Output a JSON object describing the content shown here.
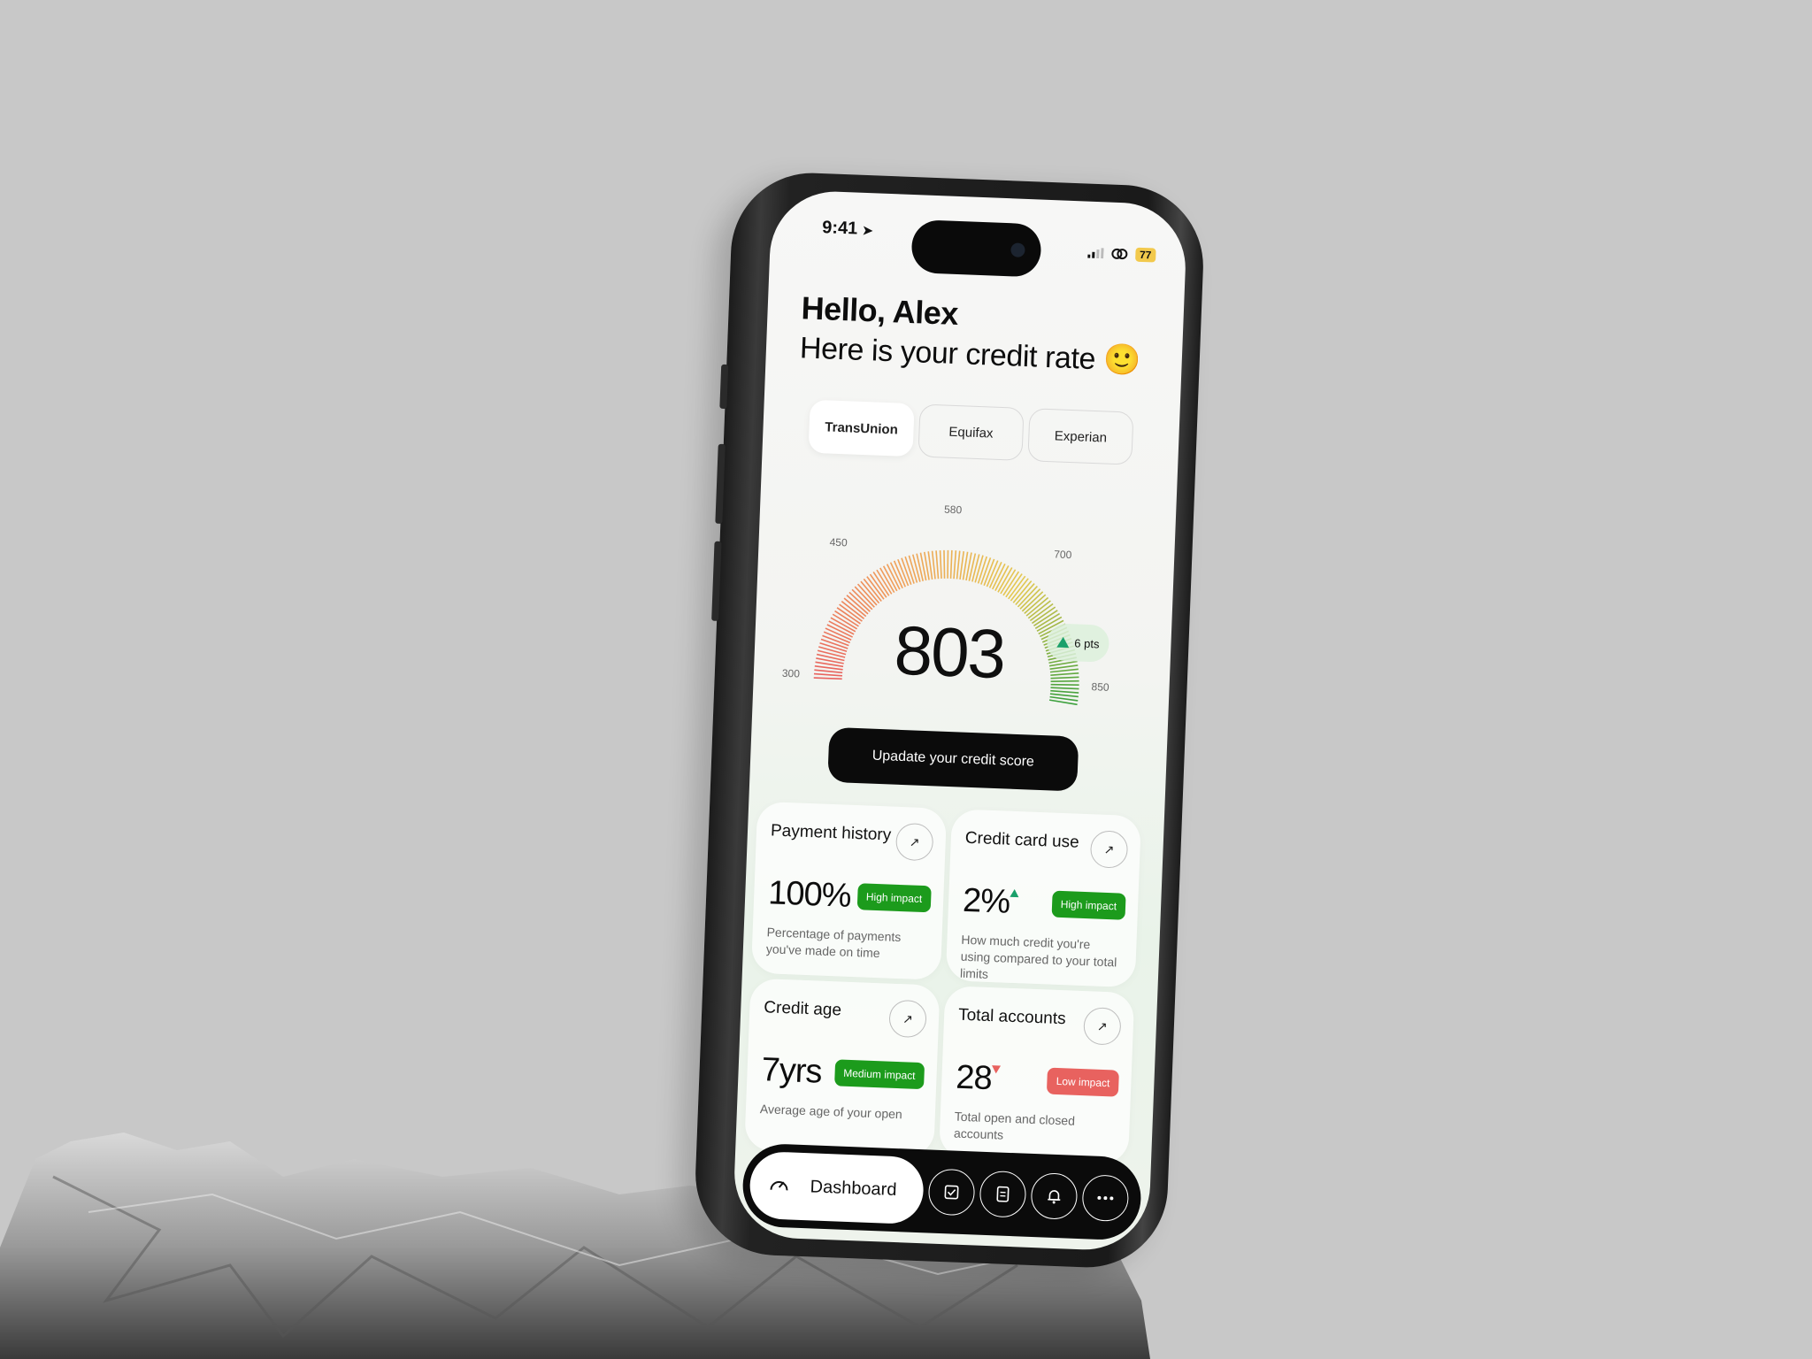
{
  "status_bar": {
    "time": "9:41",
    "battery": "77"
  },
  "header": {
    "greeting": "Hello, Alex",
    "subtitle": "Here is your credit rate 🙂"
  },
  "bureau_tabs": [
    {
      "label": "TransUnion",
      "active": true
    },
    {
      "label": "Equifax",
      "active": false
    },
    {
      "label": "Experian",
      "active": false
    }
  ],
  "gauge": {
    "min_label": "300",
    "label_450": "450",
    "label_580": "580",
    "label_700": "700",
    "max_label": "850",
    "score": "803",
    "change": "6 pts"
  },
  "cta_label": "Upadate your credit score",
  "cards": [
    {
      "title": "Payment history",
      "value": "100%",
      "impact": "High impact",
      "description": "Percentage of payments you've made on time"
    },
    {
      "title": "Credit card use",
      "value": "2%",
      "impact": "High impact",
      "description": "How much credit you're using compared to your total limits"
    },
    {
      "title": "Credit age",
      "value": "7yrs",
      "impact": "Medium impact",
      "description": "Average age of your open"
    },
    {
      "title": "Total accounts",
      "value": "28",
      "impact": "Low impact",
      "description": "Total open and closed accounts"
    }
  ],
  "nav": {
    "dashboard_label": "Dashboard",
    "icons": [
      "checklist-icon",
      "document-icon",
      "bell-icon",
      "more-icon"
    ]
  },
  "colors": {
    "good": "#1c9b1c",
    "bad": "#e8625f",
    "up": "#1aa06a"
  }
}
